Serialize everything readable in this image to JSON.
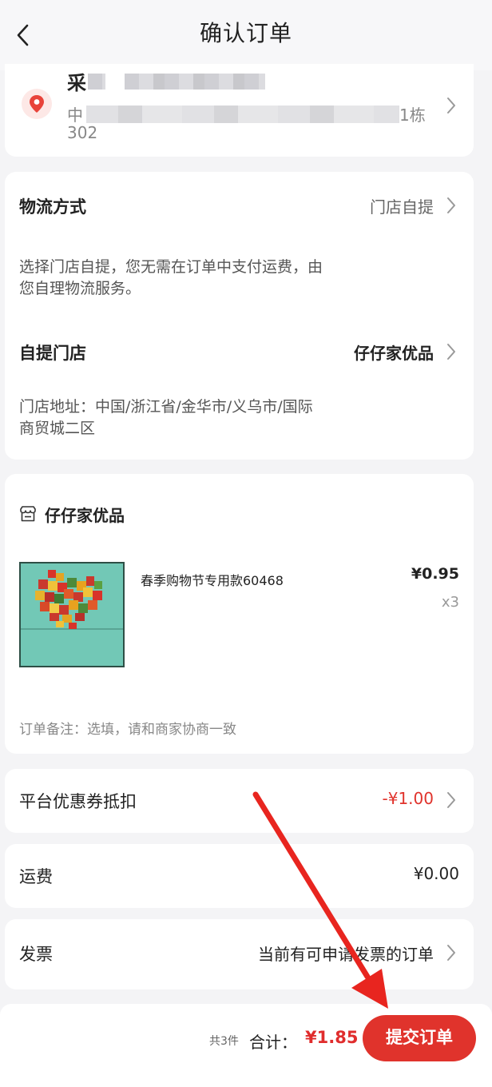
{
  "nav": {
    "title": "确认订单",
    "back_icon": "chevron-left-icon"
  },
  "address": {
    "name": "采",
    "line1_prefix": "中",
    "line1_suffix": "1栋",
    "line2": "302",
    "icon": "location-pin-icon",
    "icon_color": "#e8433a"
  },
  "logistics": {
    "method_label": "物流方式",
    "method_value": "门店自提",
    "method_note_line1": "选择门店自提，您无需在订单中支付运费，由",
    "method_note_line2": "您自理物流服务。",
    "pickup_label": "自提门店",
    "pickup_value": "仔仔家优品",
    "store_address_line1": "门店地址：中国/浙江省/金华市/义乌市/国际",
    "store_address_line2": "商贸城二区"
  },
  "shop": {
    "icon": "store-icon",
    "name": "仔仔家优品",
    "product": {
      "name": "春季购物节专用款60468",
      "price": "¥0.95",
      "quantity": "x3"
    },
    "note": "订单备注：选填，请和商家协商一致"
  },
  "coupon": {
    "label": "平台优惠券抵扣",
    "value": "-¥1.00",
    "value_color": "#e0332c"
  },
  "shipping": {
    "label": "运费",
    "value": "¥0.00"
  },
  "invoice": {
    "label": "发票",
    "value": "当前有可申请发票的订单"
  },
  "footer": {
    "count": "共3件",
    "total_label": "合计：",
    "total": "¥1.85",
    "submit_label": "提交订单",
    "accent": "#e0332c"
  }
}
